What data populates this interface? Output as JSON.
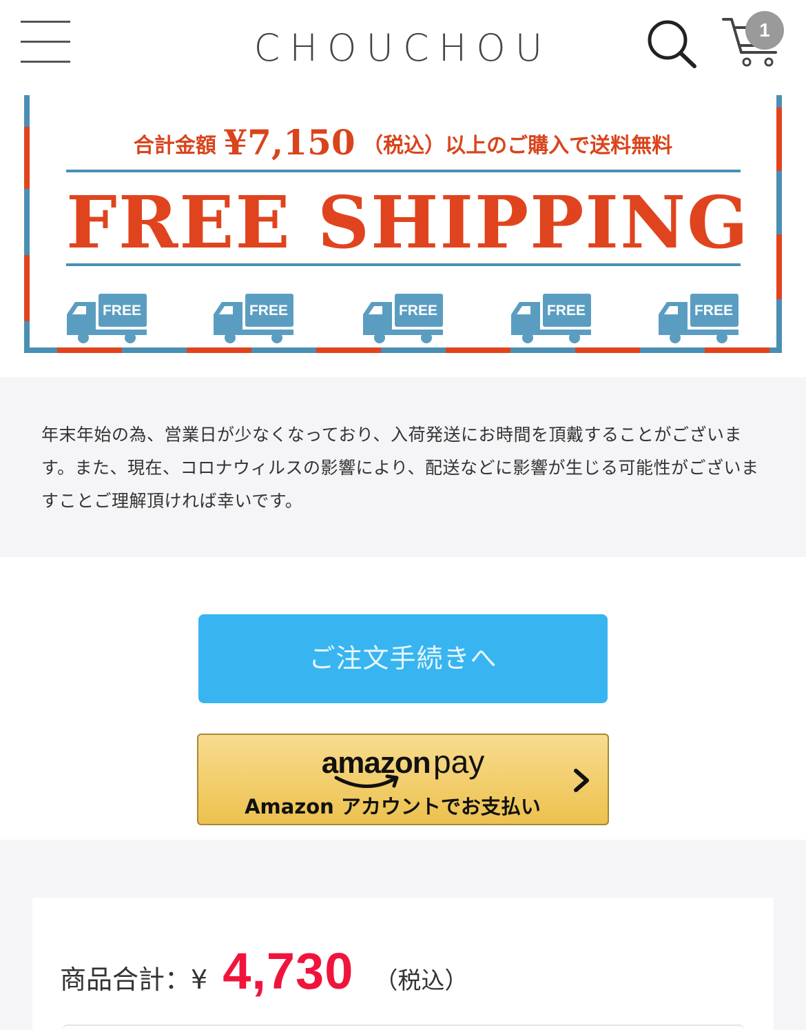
{
  "header": {
    "logo": "CHOUCHOU",
    "cart_count": "1",
    "icons": [
      "hamburger-menu-icon",
      "search-icon",
      "cart-icon"
    ]
  },
  "banner": {
    "subtitle_pre": "合計金額",
    "subtitle_amount": "¥7,150",
    "subtitle_post": "（税込）以上のご購入で送料無料",
    "title": "FREE SHIPPING",
    "truck_label": "FREE",
    "colors": {
      "red": "#e0441e",
      "blue": "#4a8fb3",
      "truck": "#5b9dc1"
    }
  },
  "notice": {
    "text": "年末年始の為、営業日が少なくなっており、入荷発送にお時間を頂戴することがございます。また、現在、コロナウィルスの影響により、配送などに影響が生じる可能性がございますことご理解頂ければ幸いです。"
  },
  "buttons": {
    "order_label": "ご注文手続きへ",
    "amazon_logo_a": "amazon",
    "amazon_logo_b": "pay",
    "amazon_sub": "Amazon アカウントでお支払い",
    "order_color": "#38b5f0"
  },
  "total": {
    "label": "商品合計：¥",
    "amount": "4,730",
    "tax": "（税込）",
    "amount_color": "#f0143c"
  }
}
